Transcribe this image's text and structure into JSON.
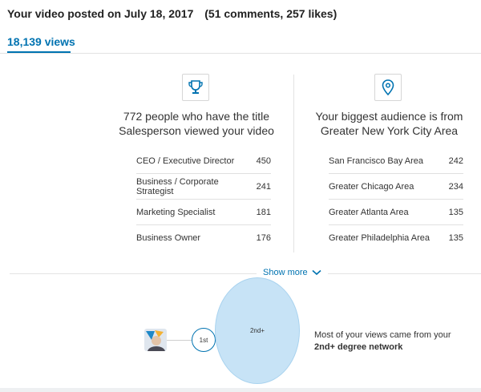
{
  "header": {
    "title": "Your video posted on July 18, 2017",
    "stats": "(51 comments, 257 likes)"
  },
  "tabs": [
    {
      "label": "18,139 views"
    }
  ],
  "titles_panel": {
    "icon": "trophy-icon",
    "title_line1": "772 people who have the title",
    "title_line2": "Salesperson viewed your video",
    "rows": [
      {
        "label": "CEO / Executive Director",
        "value": "450"
      },
      {
        "label": "Business / Corporate Strategist",
        "value": "241"
      },
      {
        "label": "Marketing Specialist",
        "value": "181"
      },
      {
        "label": "Business Owner",
        "value": "176"
      }
    ]
  },
  "locations_panel": {
    "icon": "location-pin-icon",
    "title_line1": "Your biggest audience is from",
    "title_line2": "Greater New York City Area",
    "rows": [
      {
        "label": "San Francisco Bay Area",
        "value": "242"
      },
      {
        "label": "Greater Chicago Area",
        "value": "234"
      },
      {
        "label": "Greater Atlanta Area",
        "value": "135"
      },
      {
        "label": "Greater Philadelphia Area",
        "value": "135"
      }
    ]
  },
  "show_more": {
    "label": "Show more",
    "icon": "chevron-down-icon"
  },
  "network": {
    "first_degree_label": "1st",
    "second_degree_label": "2nd+",
    "text_line1": "Most of your views came from your",
    "text_line2": "2nd+ degree network"
  },
  "colors": {
    "accent": "#0073b1",
    "bubble_fill": "#c7e3f6"
  }
}
